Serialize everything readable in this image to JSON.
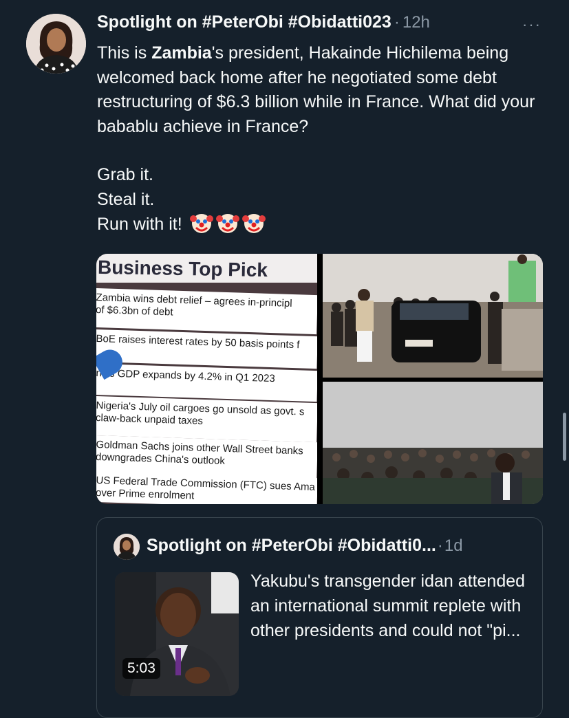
{
  "tweet": {
    "author": "Spotlight on #PeterObi #Obidatti023",
    "separator": "·",
    "time": "12h",
    "more": "···",
    "text_part1": "This is ",
    "text_bold": "Zambia",
    "text_part2": "'s president, Hakainde Hichilema being welcomed back home after he negotiated some debt restructuring of $6.3 billion while in France. What did your babablu achieve in France?",
    "line1": "Grab it.",
    "line2": "Steal it.",
    "line3": "Run with it!",
    "emoji": "clown-face-emoji"
  },
  "media": {
    "screen_title": "Business Top Pick",
    "headlines": [
      [
        "Zambia wins debt relief – agrees in-principl",
        "of $6.3bn of debt"
      ],
      [
        "BoE raises interest rates by 50 basis points f"
      ],
      [
        "na's GDP expands by 4.2% in Q1 2023"
      ],
      [
        "Nigeria's July oil cargoes go unsold as govt. s",
        "claw-back unpaid taxes"
      ],
      [
        "Goldman Sachs joins other Wall Street banks",
        "downgrades China's outlook"
      ],
      [
        "US Federal Trade Commission (FTC) sues Ama",
        "over Prime enrolment"
      ]
    ]
  },
  "quote": {
    "author": "Spotlight on #PeterObi #Obidatti0...",
    "separator": "·",
    "time": "1d",
    "text": "Yakubu's transgender idan attended an international summit replete with other presidents and could not \"pi...",
    "video_duration": "5:03"
  },
  "colors": {
    "background": "#15202b",
    "text": "#f7f9f9",
    "muted": "#8b98a5",
    "border": "#38444d"
  }
}
